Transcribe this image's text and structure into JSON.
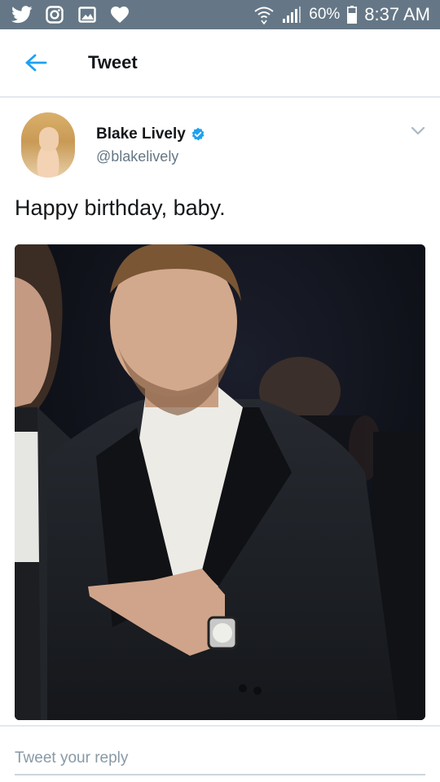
{
  "status_bar": {
    "battery_percent": "60%",
    "time": "8:37 AM",
    "left_icons": [
      "twitter-icon",
      "instagram-icon",
      "gallery-icon",
      "heart-icon"
    ],
    "right_icons": [
      "wifi-icon",
      "signal-icon",
      "battery-icon"
    ]
  },
  "header": {
    "title": "Tweet",
    "back_icon": "back-arrow-icon"
  },
  "tweet": {
    "author_name": "Blake Lively",
    "author_handle": "@blakelively",
    "text": "Happy birthday, baby.",
    "verified": true
  },
  "reply": {
    "placeholder": "Tweet your reply"
  },
  "colors": {
    "status_bar_bg": "#657786",
    "accent": "#1da1f2",
    "text_primary": "#14171a",
    "text_secondary": "#657786",
    "divider": "#e1e8ed"
  }
}
